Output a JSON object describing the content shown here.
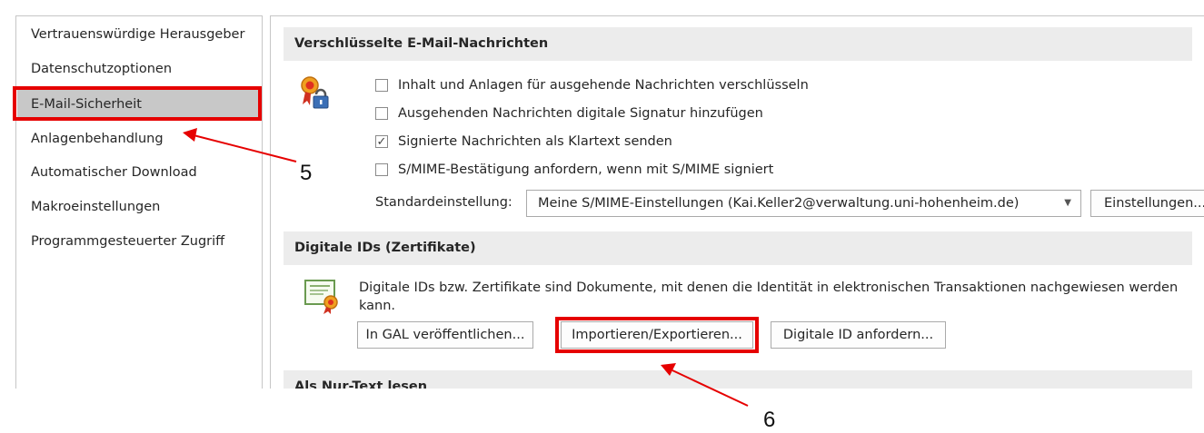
{
  "nav": {
    "items": [
      {
        "label": "Vertrauenswürdige Herausgeber",
        "selected": false
      },
      {
        "label": "Datenschutzoptionen",
        "selected": false
      },
      {
        "label": "E-Mail-Sicherheit",
        "selected": true
      },
      {
        "label": "Anlagenbehandlung",
        "selected": false
      },
      {
        "label": "Automatischer Download",
        "selected": false
      },
      {
        "label": "Makroeinstellungen",
        "selected": false
      },
      {
        "label": "Programmgesteuerter Zugriff",
        "selected": false
      }
    ]
  },
  "encrypted_section": {
    "title": "Verschlüsselte E-Mail-Nachrichten",
    "icon": "certificate-lock-icon",
    "options": [
      {
        "label": "Inhalt und Anlagen für ausgehende Nachrichten verschlüsseln",
        "checked": false
      },
      {
        "label": "Ausgehenden Nachrichten digitale Signatur hinzufügen",
        "checked": false
      },
      {
        "label": "Signierte Nachrichten als Klartext senden",
        "checked": true
      },
      {
        "label": "S/MIME-Bestätigung anfordern, wenn mit S/MIME signiert",
        "checked": false
      }
    ],
    "default_setting_label": "Standardeinstellung:",
    "default_setting_value": "Meine S/MIME-Einstellungen (Kai.Keller2@verwaltung.uni-hohenheim.de)",
    "settings_button": "Einstellungen..."
  },
  "digital_ids_section": {
    "title": "Digitale IDs (Zertifikate)",
    "icon": "certificate-icon",
    "description": "Digitale IDs bzw. Zertifikate sind Dokumente, mit denen die Identität in elektronischen Transaktionen nachgewiesen werden kann.",
    "buttons": {
      "publish": "In GAL veröffentlichen...",
      "import_export": "Importieren/Exportieren...",
      "request": "Digitale ID anfordern..."
    }
  },
  "plain_text_section": {
    "title": "Als Nur-Text lesen"
  },
  "annotations": {
    "step5": "5",
    "step6": "6",
    "highlight_color": "#e60000"
  }
}
